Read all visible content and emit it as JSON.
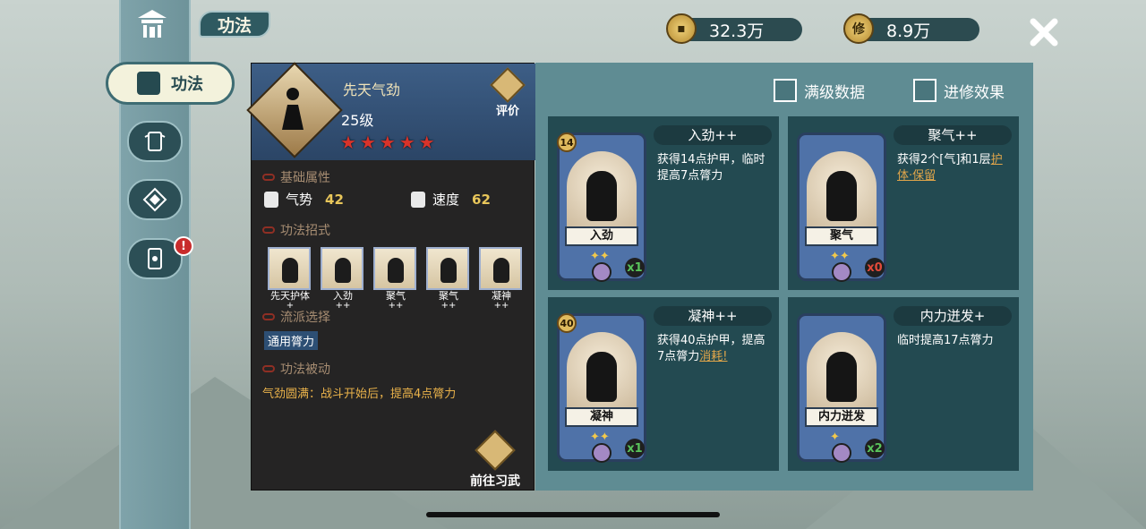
{
  "nav": {
    "title": "功法",
    "active_label": "功法",
    "alert": "!"
  },
  "currency": [
    {
      "icon": "coin-icon",
      "value": "32.3万"
    },
    {
      "icon": "cultivation-coin-icon",
      "glyph": "修",
      "value": "8.9万"
    }
  ],
  "detail": {
    "name": "先天气劲",
    "level": "25级",
    "stars": 5,
    "eval_label": "评价",
    "basic_attr_title": "基础属性",
    "attrs": [
      {
        "name": "气势",
        "value": "42"
      },
      {
        "name": "速度",
        "value": "62"
      }
    ],
    "moves_title": "功法招式",
    "moves": [
      {
        "name": "先天护体",
        "plus": "+"
      },
      {
        "name": "入劲",
        "plus": "++"
      },
      {
        "name": "聚气",
        "plus": "++"
      },
      {
        "name": "聚气",
        "plus": "++"
      },
      {
        "name": "凝神",
        "plus": "++"
      }
    ],
    "school_title": "流派选择",
    "school_value": "通用膂力",
    "passive_title": "功法被动",
    "passive_text": "气劲圆满：战斗开始后，提高4点膂力",
    "goto_label": "前往习武"
  },
  "checkboxes": [
    {
      "label": "满级数据",
      "checked": false
    },
    {
      "label": "进修效果",
      "checked": false
    }
  ],
  "cards": [
    {
      "title": "入劲++",
      "card_name": "入劲",
      "cost": "14",
      "count": "x1",
      "count_color": "green",
      "desc": "获得14点护甲，临时提高7点膂力",
      "highlight": ""
    },
    {
      "title": "聚气++",
      "card_name": "聚气",
      "cost": "",
      "count": "x0",
      "count_color": "red",
      "desc": "获得2个[气]和1层",
      "highlight": "护体·保留"
    },
    {
      "title": "凝神++",
      "card_name": "凝神",
      "cost": "40",
      "count": "x1",
      "count_color": "green",
      "desc": "获得40点护甲，提高7点膂力",
      "highlight": "消耗!"
    },
    {
      "title": "内力迸发+",
      "card_name": "内力迸发",
      "cost": "",
      "count": "x2",
      "count_color": "green",
      "desc": "临时提高17点膂力",
      "highlight": ""
    }
  ]
}
